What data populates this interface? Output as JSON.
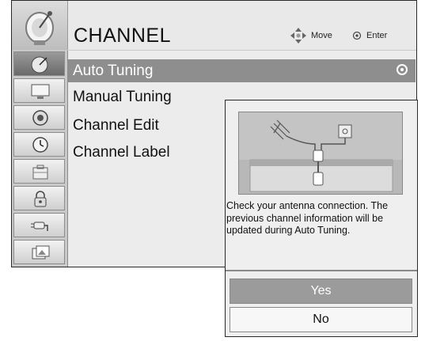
{
  "header": {
    "title": "CHANNEL",
    "move_label": "Move",
    "enter_label": "Enter"
  },
  "sidebar": {
    "icons": [
      "satellite-dish-icon",
      "monitor-icon",
      "speaker-icon",
      "clock-icon",
      "lock-icon",
      "padlock-icon",
      "plug-icon",
      "picture-icon"
    ]
  },
  "menu": {
    "items": [
      "Auto Tuning",
      "Manual Tuning",
      "Channel Edit",
      "Channel Label"
    ]
  },
  "popup": {
    "message": "Check your antenna connection. The previous channel information will be updated during Auto Tuning.",
    "yes_label": "Yes",
    "no_label": "No"
  },
  "colors": {
    "selected_row": "#8e8e8e",
    "yes_button": "#9b9b9b"
  }
}
